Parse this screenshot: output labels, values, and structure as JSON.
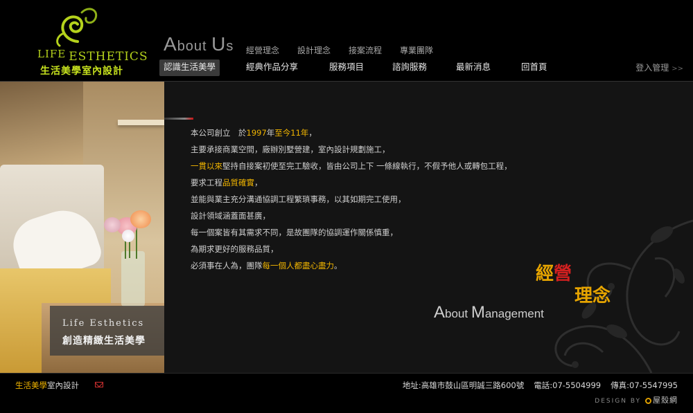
{
  "logo": {
    "brand_line1": "LIFE",
    "brand_line2": "ESTHETICS",
    "chinese_name": "生活美學室內設計"
  },
  "header": {
    "section_title_first_letter": "A",
    "section_title_rest": "bout ",
    "section_title_second_letter": "U",
    "section_title_end": "s",
    "sub_nav": [
      "經營理念",
      "設計理念",
      "接案流程",
      "專業團隊"
    ],
    "main_nav": [
      "認識生活美學",
      "經典作品分享",
      "服務項目",
      "諮詢服務",
      "最新消息",
      "回首頁"
    ],
    "active_nav_index": 0,
    "login_label": "登入管理"
  },
  "photo_caption": {
    "english": "Life Esthetics",
    "chinese": "創造精緻生活美學"
  },
  "content": {
    "line1_a": "本公司創立　於",
    "line1_hl1": "1997",
    "line1_b": "年",
    "line1_hl2": "至今11年",
    "line1_c": "，",
    "line2": "主要承接商業空間，廠辦別墅營建，室內設計規劃施工，",
    "line3_hl": "一貫以來",
    "line3_rest": "堅持自接案初使至完工驗收，皆由公司上下 一條線執行，不假予他人或轉包工程，",
    "line4_a": "要求工程",
    "line4_hl": "品質確實",
    "line4_b": "，",
    "line5": "並能與業主充分溝通協調工程繁瑣事務，以其如期完工使用，",
    "line6": "設計領域涵蓋面甚廣，",
    "line7": "每一個案皆有其需求不同，是故團隊的協調運作關係慎重，",
    "line8": "為期求更好的服務品質，",
    "line9_a": "必須事在人為，團隊",
    "line9_hl": "每一個人都盡心盡力",
    "line9_b": "。",
    "mgmt_title_part1": "經",
    "mgmt_title_part2": "營",
    "mgmt_title_line2": "理念",
    "mgmt_en_first": "A",
    "mgmt_en_rest1": "bout ",
    "mgmt_en_second": "M",
    "mgmt_en_rest2": "anagement"
  },
  "footer": {
    "brand_a": "生活美學",
    "brand_b": "室內設計",
    "address": "地址:高雄市鼓山區明誠三路600號",
    "phone": "電話:07-5504999",
    "fax": "傳真:07-5547995",
    "design_by": "DESIGN BY",
    "designer": "屋殼網"
  },
  "colors": {
    "accent_yellow": "#f0b400",
    "logo_green": "#b5d21c",
    "title_red": "#d42020",
    "background": "#000000",
    "panel": "#141414"
  }
}
